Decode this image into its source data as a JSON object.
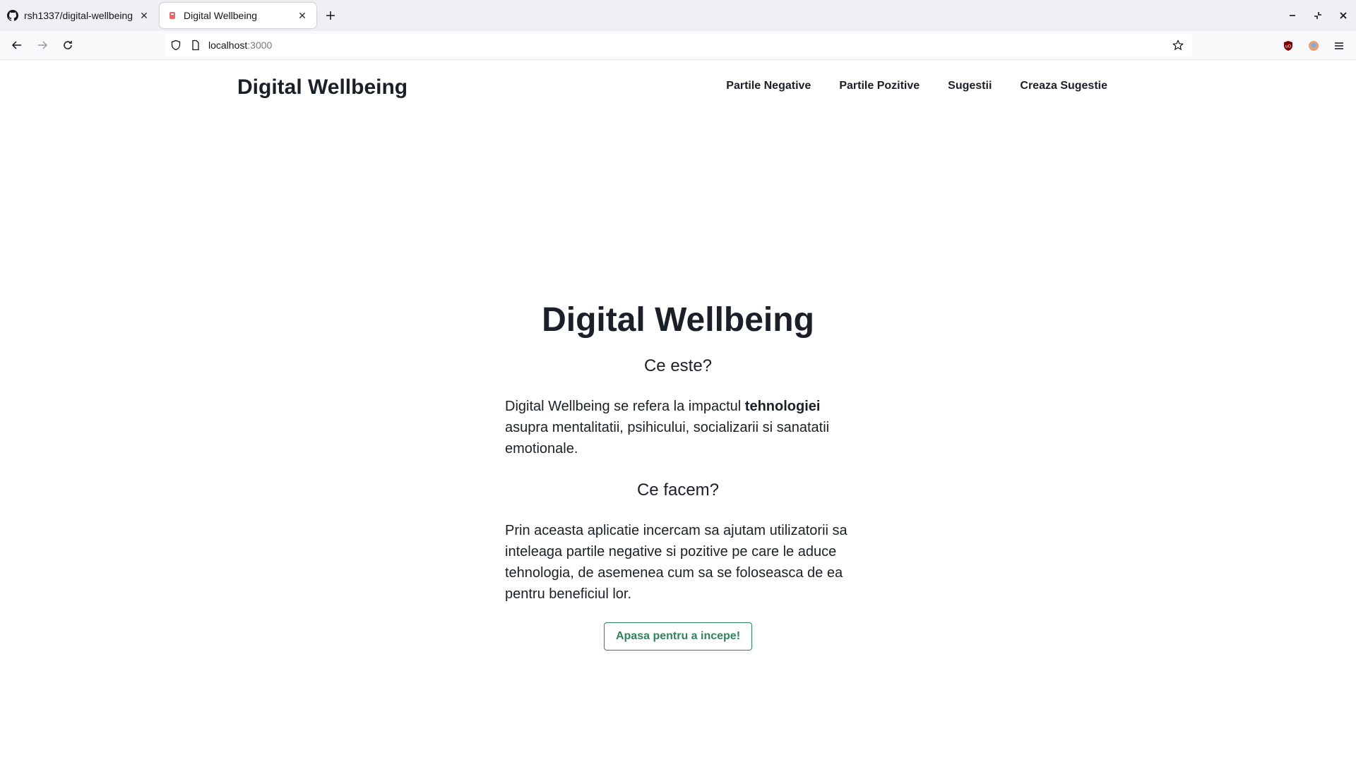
{
  "browser": {
    "tabs": [
      {
        "title": "rsh1337/digital-wellbeing",
        "icon": "github-icon",
        "active": false
      },
      {
        "title": "Digital Wellbeing",
        "icon": "site-favicon",
        "active": true
      }
    ],
    "url_host": "localhost",
    "url_port": ":3000"
  },
  "site": {
    "brand": "Digital Wellbeing",
    "nav": [
      "Partile Negative",
      "Partile Pozitive",
      "Sugestii",
      "Creaza Sugestie"
    ]
  },
  "hero": {
    "title": "Digital Wellbeing",
    "section1_heading": "Ce este?",
    "section1_text_before": "Digital Wellbeing se refera la impactul ",
    "section1_text_bold": "tehnologiei",
    "section1_text_after": " asupra mentalitatii, psihicului, socializarii si sanatatii emotionale.",
    "section2_heading": "Ce facem?",
    "section2_text": "Prin aceasta aplicatie incercam sa ajutam utilizatorii sa inteleaga partile negative si pozitive pe care le aduce tehnologia, de asemenea cum sa se foloseasca de ea pentru beneficiul lor.",
    "cta_label": "Apasa pentru a incepe!"
  },
  "colors": {
    "text": "#1b1f27",
    "accent_green": "#2f855a",
    "chrome_bg": "#f0f0f4"
  }
}
